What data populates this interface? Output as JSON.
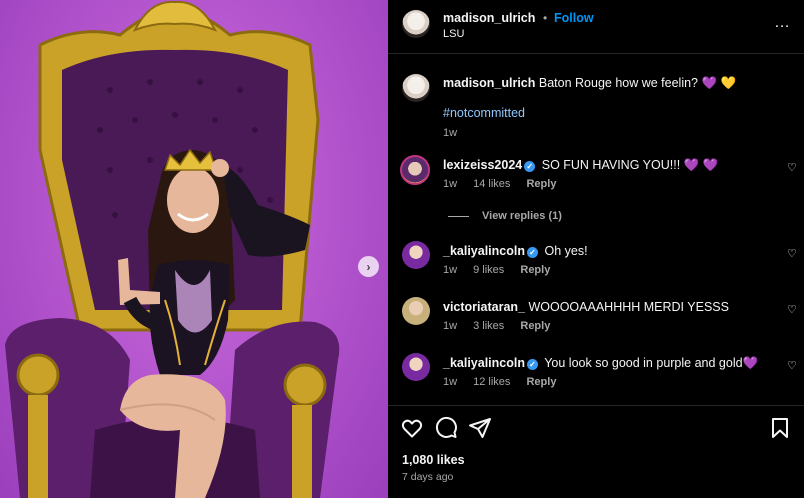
{
  "post": {
    "username": "madison_ulrich",
    "follow_label": "Follow",
    "dot": "•",
    "location": "LSU",
    "more": "…"
  },
  "caption": {
    "username": "madison_ulrich",
    "text": "Baton Rouge how we feelin? 💜 💛",
    "hashtag": "#notcommitted",
    "time": "1w"
  },
  "comments": [
    {
      "username": "lexizeiss2024",
      "verified": true,
      "text": "SO FUN HAVING YOU!!! 💜 💜",
      "time": "1w",
      "likes": "14 likes",
      "reply": "Reply"
    },
    {
      "username": "_kaliyalincoln",
      "verified": true,
      "text": "Oh yes!",
      "time": "1w",
      "likes": "9 likes",
      "reply": "Reply"
    },
    {
      "username": "victoriataran_",
      "verified": false,
      "text": "WOOOOAAAHHHH MERDI YESSS",
      "time": "1w",
      "likes": "3 likes",
      "reply": "Reply"
    },
    {
      "username": "_kaliyalincoln",
      "verified": true,
      "text": "You look so good in purple and gold💜",
      "time": "1w",
      "likes": "12 likes",
      "reply": "Reply"
    }
  ],
  "view_replies": "View replies (1)",
  "likes_count": "1,080 likes",
  "date": "7 days ago",
  "icons": {
    "next": "chevron-right-icon",
    "heart": "heart-icon",
    "comment": "comment-icon",
    "share": "paper-plane-icon",
    "save": "bookmark-icon"
  },
  "colors": {
    "accent": "#0095f6",
    "background": "#000000",
    "photo_backdrop": "#b657cf",
    "throne_gold": "#c9a227",
    "throne_velvet": "#4a1a57"
  }
}
